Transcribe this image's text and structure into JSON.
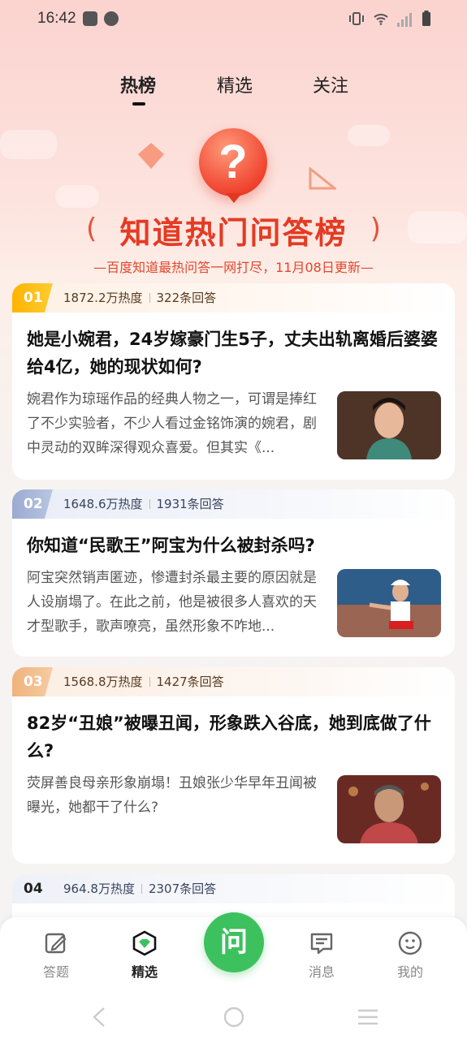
{
  "status_bar": {
    "time": "16:42"
  },
  "top_tabs": [
    {
      "label": "热榜",
      "active": true
    },
    {
      "label": "精选",
      "active": false
    },
    {
      "label": "关注",
      "active": false
    }
  ],
  "banner": {
    "title": "知道热门问答榜",
    "subtitle": "—百度知道最热问答一网打尽，11月08日更新—",
    "icon": "question-mark-icon"
  },
  "items": [
    {
      "rank": "01",
      "heat": "1872.2万热度",
      "answers": "322条回答",
      "title": "她是小婉君，24岁嫁豪门生5子，丈夫出轨离婚后婆婆给4亿，她的现状如何?",
      "desc": "婉君作为琼瑶作品的经典人物之一，可谓是捧红了不少实验者，不少人看过金铭饰演的婉君，剧中灵动的双眸深得观众喜爱。但其实《..."
    },
    {
      "rank": "02",
      "heat": "1648.6万热度",
      "answers": "1931条回答",
      "title": "你知道“民歌王”阿宝为什么被封杀吗?",
      "desc": "阿宝突然销声匿迹，惨遭封杀最主要的原因就是人设崩塌了。在此之前，他是被很多人喜欢的天才型歌手，歌声嘹亮，虽然形象不咋地..."
    },
    {
      "rank": "03",
      "heat": "1568.8万热度",
      "answers": "1427条回答",
      "title": "82岁“丑娘”被曝丑闻，形象跌入谷底，她到底做了什么?",
      "desc": "荧屏善良母亲形象崩塌！丑娘张少华早年丑闻被曝光，她都干了什么?"
    },
    {
      "rank": "04",
      "heat": "964.8万热度",
      "answers": "2307条回答"
    }
  ],
  "bottom_nav": {
    "items": [
      {
        "label": "答题",
        "icon": "edit-icon"
      },
      {
        "label": "精选",
        "icon": "featured-icon"
      },
      {
        "label": "消息",
        "icon": "message-icon"
      },
      {
        "label": "我的",
        "icon": "profile-icon"
      }
    ],
    "ask_label": "问"
  },
  "colors": {
    "accent_green": "#3dc15e",
    "banner_red": "#e53a23",
    "rank1": "#ffb300",
    "rank2": "#9aaad0",
    "rank3": "#f0b37c"
  }
}
